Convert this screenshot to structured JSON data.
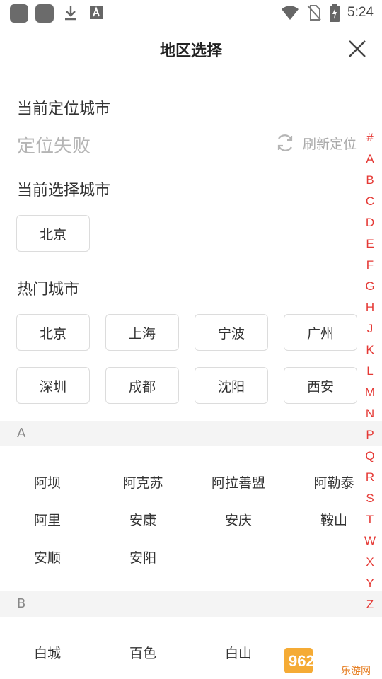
{
  "status_bar": {
    "time": "5:24",
    "icons": [
      "app-icon",
      "app-icon",
      "download-icon",
      "font-icon",
      "wifi-icon",
      "no-sim-icon",
      "battery-charging-icon"
    ]
  },
  "header": {
    "title": "地区选择"
  },
  "location": {
    "current_label": "当前定位城市",
    "status_text": "定位失败",
    "refresh_label": "刷新定位"
  },
  "selected": {
    "label": "当前选择城市",
    "city": "北京"
  },
  "hot": {
    "label": "热门城市",
    "cities": [
      "北京",
      "上海",
      "宁波",
      "广州",
      "深圳",
      "成都",
      "沈阳",
      "西安"
    ]
  },
  "groups": [
    {
      "letter": "A",
      "cities": [
        "阿坝",
        "阿克苏",
        "阿拉善盟",
        "阿勒泰",
        "阿里",
        "安康",
        "安庆",
        "鞍山",
        "安顺",
        "安阳"
      ]
    },
    {
      "letter": "B",
      "cities": [
        "白城",
        "百色",
        "白山"
      ]
    }
  ],
  "index_letters": [
    "#",
    "A",
    "B",
    "C",
    "D",
    "E",
    "F",
    "G",
    "H",
    "J",
    "K",
    "L",
    "M",
    "N",
    "P",
    "Q",
    "R",
    "S",
    "T",
    "W",
    "X",
    "Y",
    "Z"
  ],
  "watermark": {
    "text": "962.NET",
    "subtext": "乐游网"
  },
  "colors": {
    "accent": "#e53935",
    "muted": "#b5b5b5",
    "group_bg": "#f4f4f4"
  }
}
